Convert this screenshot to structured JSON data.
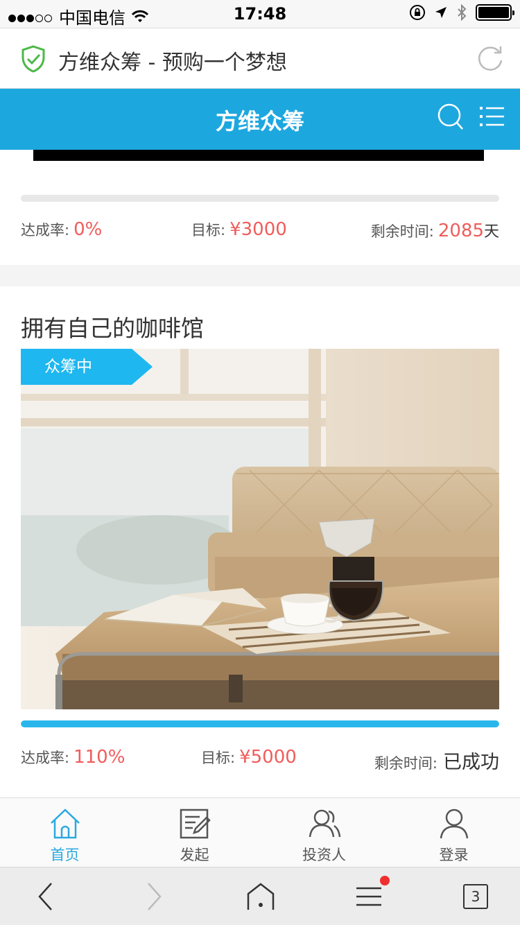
{
  "status_bar": {
    "carrier": "中国电信",
    "time": "17:48"
  },
  "address_bar": {
    "page_title": "方维众筹 - 预购一个梦想",
    "icons": [
      "shield-check-icon",
      "reload-icon"
    ]
  },
  "header": {
    "title": "方维众筹",
    "icons": [
      "search-icon",
      "menu-icon"
    ]
  },
  "projects": [
    {
      "title": "",
      "progress": 0,
      "rate_label": "达成率:",
      "rate_value": "0%",
      "goal_label": "目标:",
      "goal_value": "¥3000",
      "time_label": "剩余时间:",
      "time_value": "2085",
      "time_unit": "天"
    },
    {
      "title": "拥有自己的咖啡馆",
      "badge": "众筹中",
      "progress": 1.0,
      "rate_label": "达成率:",
      "rate_value": "110%",
      "goal_label": "目标:",
      "goal_value": "¥5000",
      "time_label": "剩余时间:",
      "time_value": "已成功"
    }
  ],
  "tabbar": {
    "items": [
      {
        "label": "首页",
        "icon": "home-icon",
        "active": true
      },
      {
        "label": "发起",
        "icon": "edit-icon",
        "active": false
      },
      {
        "label": "投资人",
        "icon": "investors-icon",
        "active": false
      },
      {
        "label": "登录",
        "icon": "user-icon",
        "active": false
      }
    ]
  },
  "browser_bar": {
    "tab_count": "3",
    "icons": [
      "back-icon",
      "forward-icon",
      "home-icon",
      "menu-icon",
      "tabs-icon"
    ]
  },
  "colors": {
    "primary": "#1da7df",
    "accent_red": "#ef5d5b",
    "progress": "#29b6ec"
  }
}
